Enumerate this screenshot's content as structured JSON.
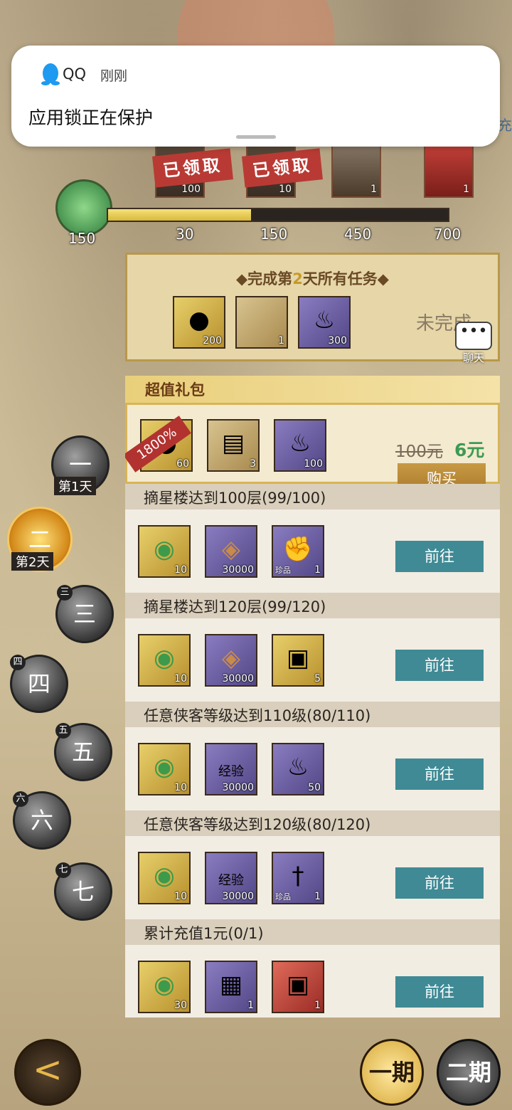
{
  "notification": {
    "app_name": "QQ",
    "time": "刚刚",
    "message": "应用锁正在保护",
    "edge_text": "充"
  },
  "top_rewards": {
    "claimed_label": "已领取",
    "items": [
      {
        "count": "100",
        "claimed": true
      },
      {
        "count": "10",
        "claimed": true
      },
      {
        "count": "1",
        "claimed": false
      },
      {
        "count": "1",
        "claimed": false
      }
    ],
    "current_points": "150",
    "progress_fraction": 0.42,
    "milestones": [
      "30",
      "150",
      "450",
      "700"
    ]
  },
  "day_panel": {
    "title_prefix": "◆完成第",
    "day_number": "2",
    "title_suffix": "天所有任务◆",
    "items": [
      {
        "count": "200"
      },
      {
        "count": "1"
      },
      {
        "count": "300"
      }
    ],
    "status": "未完成"
  },
  "chat": {
    "label": "聊天",
    "glyph": "•••"
  },
  "gift_pack": {
    "header": "超值礼包",
    "ribbon": "1800%",
    "items": [
      {
        "count": "60"
      },
      {
        "count": "3"
      },
      {
        "count": "100"
      }
    ],
    "old_price": "100元",
    "new_price": "6元",
    "buy_label": "购买"
  },
  "tasks": [
    {
      "title": "摘星楼达到100层(99/100)",
      "items": [
        {
          "count": "10",
          "tag": ""
        },
        {
          "count": "30000",
          "tag": ""
        },
        {
          "count": "1",
          "tag": "珍品"
        }
      ],
      "button": "前往"
    },
    {
      "title": "摘星楼达到120层(99/120)",
      "items": [
        {
          "count": "10",
          "tag": ""
        },
        {
          "count": "30000",
          "tag": ""
        },
        {
          "count": "5",
          "tag": ""
        }
      ],
      "button": "前往"
    },
    {
      "title": "任意侠客等级达到110级(80/110)",
      "items": [
        {
          "count": "10",
          "tag": ""
        },
        {
          "count": "30000",
          "tag": "经验"
        },
        {
          "count": "50",
          "tag": ""
        }
      ],
      "button": "前往"
    },
    {
      "title": "任意侠客等级达到120级(80/120)",
      "items": [
        {
          "count": "10",
          "tag": ""
        },
        {
          "count": "30000",
          "tag": "经验"
        },
        {
          "count": "1",
          "tag": "珍品"
        }
      ],
      "button": "前往"
    },
    {
      "title": "累计充值1元(0/1)",
      "items": [
        {
          "count": "30",
          "tag": ""
        },
        {
          "count": "1",
          "tag": ""
        },
        {
          "count": "1",
          "tag": ""
        }
      ],
      "button": "前往"
    }
  ],
  "days": [
    {
      "glyph": "一",
      "label": "第1天",
      "badge": ""
    },
    {
      "glyph": "二",
      "label": "第2天",
      "badge": ""
    },
    {
      "glyph": "三",
      "label": "",
      "badge": "三"
    },
    {
      "glyph": "四",
      "label": "",
      "badge": "四"
    },
    {
      "glyph": "五",
      "label": "",
      "badge": "五"
    },
    {
      "glyph": "六",
      "label": "",
      "badge": "六"
    },
    {
      "glyph": "七",
      "label": "",
      "badge": "七"
    }
  ],
  "bottom": {
    "back_glyph": "<",
    "period1": "一期",
    "period2": "二期"
  }
}
